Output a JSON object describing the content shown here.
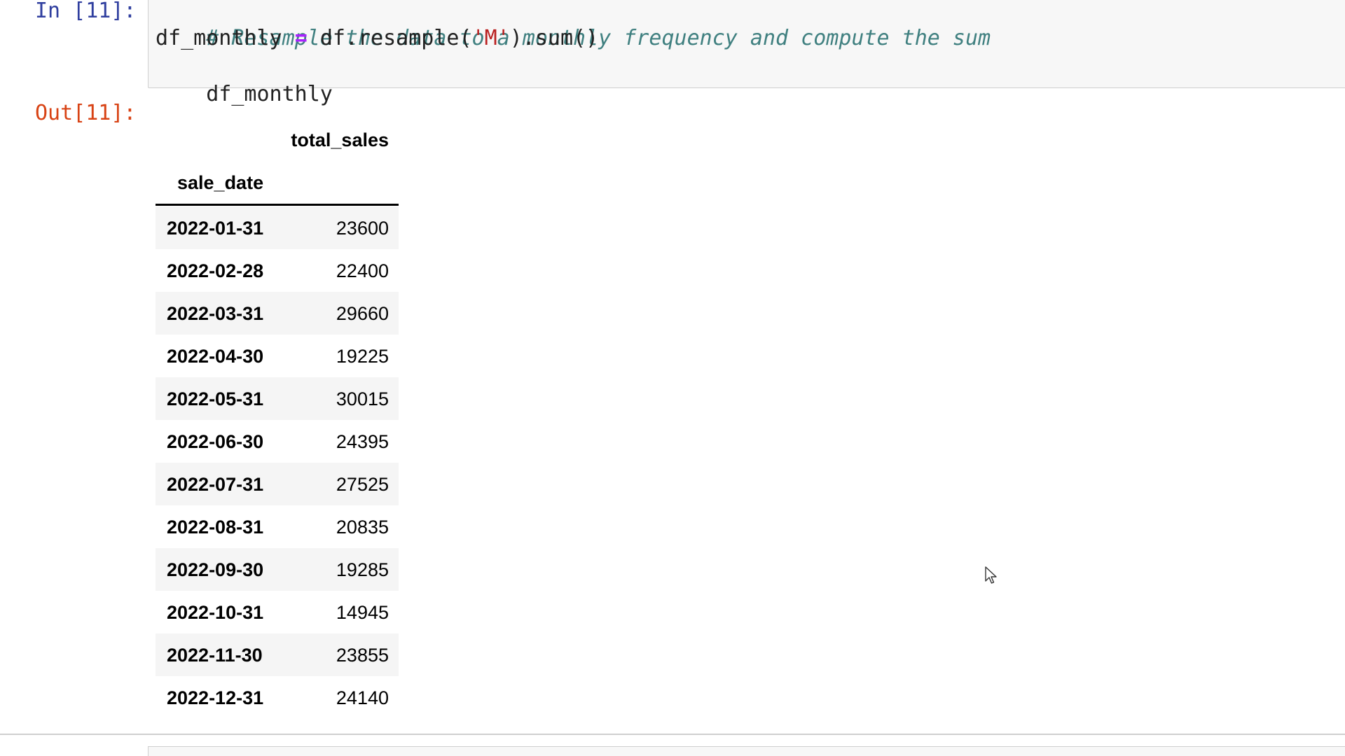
{
  "input_cell": {
    "prompt": "In [11]:",
    "code": {
      "comment": "# Resample the data to a monthly frequency and compute the sum",
      "line2_var": "df_monthly",
      "line2_op": "=",
      "line2_call_start": "df.resample(",
      "line2_string": "'M'",
      "line2_call_end": ").sum()",
      "line3": "df_monthly"
    }
  },
  "output_cell": {
    "prompt": "Out[11]:",
    "dataframe": {
      "column_header": "total_sales",
      "index_name": "sale_date",
      "rows": [
        {
          "index": "2022-01-31",
          "value": "23600"
        },
        {
          "index": "2022-02-28",
          "value": "22400"
        },
        {
          "index": "2022-03-31",
          "value": "29660"
        },
        {
          "index": "2022-04-30",
          "value": "19225"
        },
        {
          "index": "2022-05-31",
          "value": "30015"
        },
        {
          "index": "2022-06-30",
          "value": "24395"
        },
        {
          "index": "2022-07-31",
          "value": "27525"
        },
        {
          "index": "2022-08-31",
          "value": "20835"
        },
        {
          "index": "2022-09-30",
          "value": "19285"
        },
        {
          "index": "2022-10-31",
          "value": "14945"
        },
        {
          "index": "2022-11-30",
          "value": "23855"
        },
        {
          "index": "2022-12-31",
          "value": "24140"
        }
      ]
    }
  },
  "icons": {
    "cursor": "mouse-pointer-icon"
  },
  "colors": {
    "in_prompt": "#303f9f",
    "out_prompt": "#d84315",
    "comment": "#408080",
    "operator": "#aa22ff",
    "string": "#ba2121",
    "input_bg": "#f7f7f7",
    "odd_row_bg": "#f5f5f5"
  }
}
